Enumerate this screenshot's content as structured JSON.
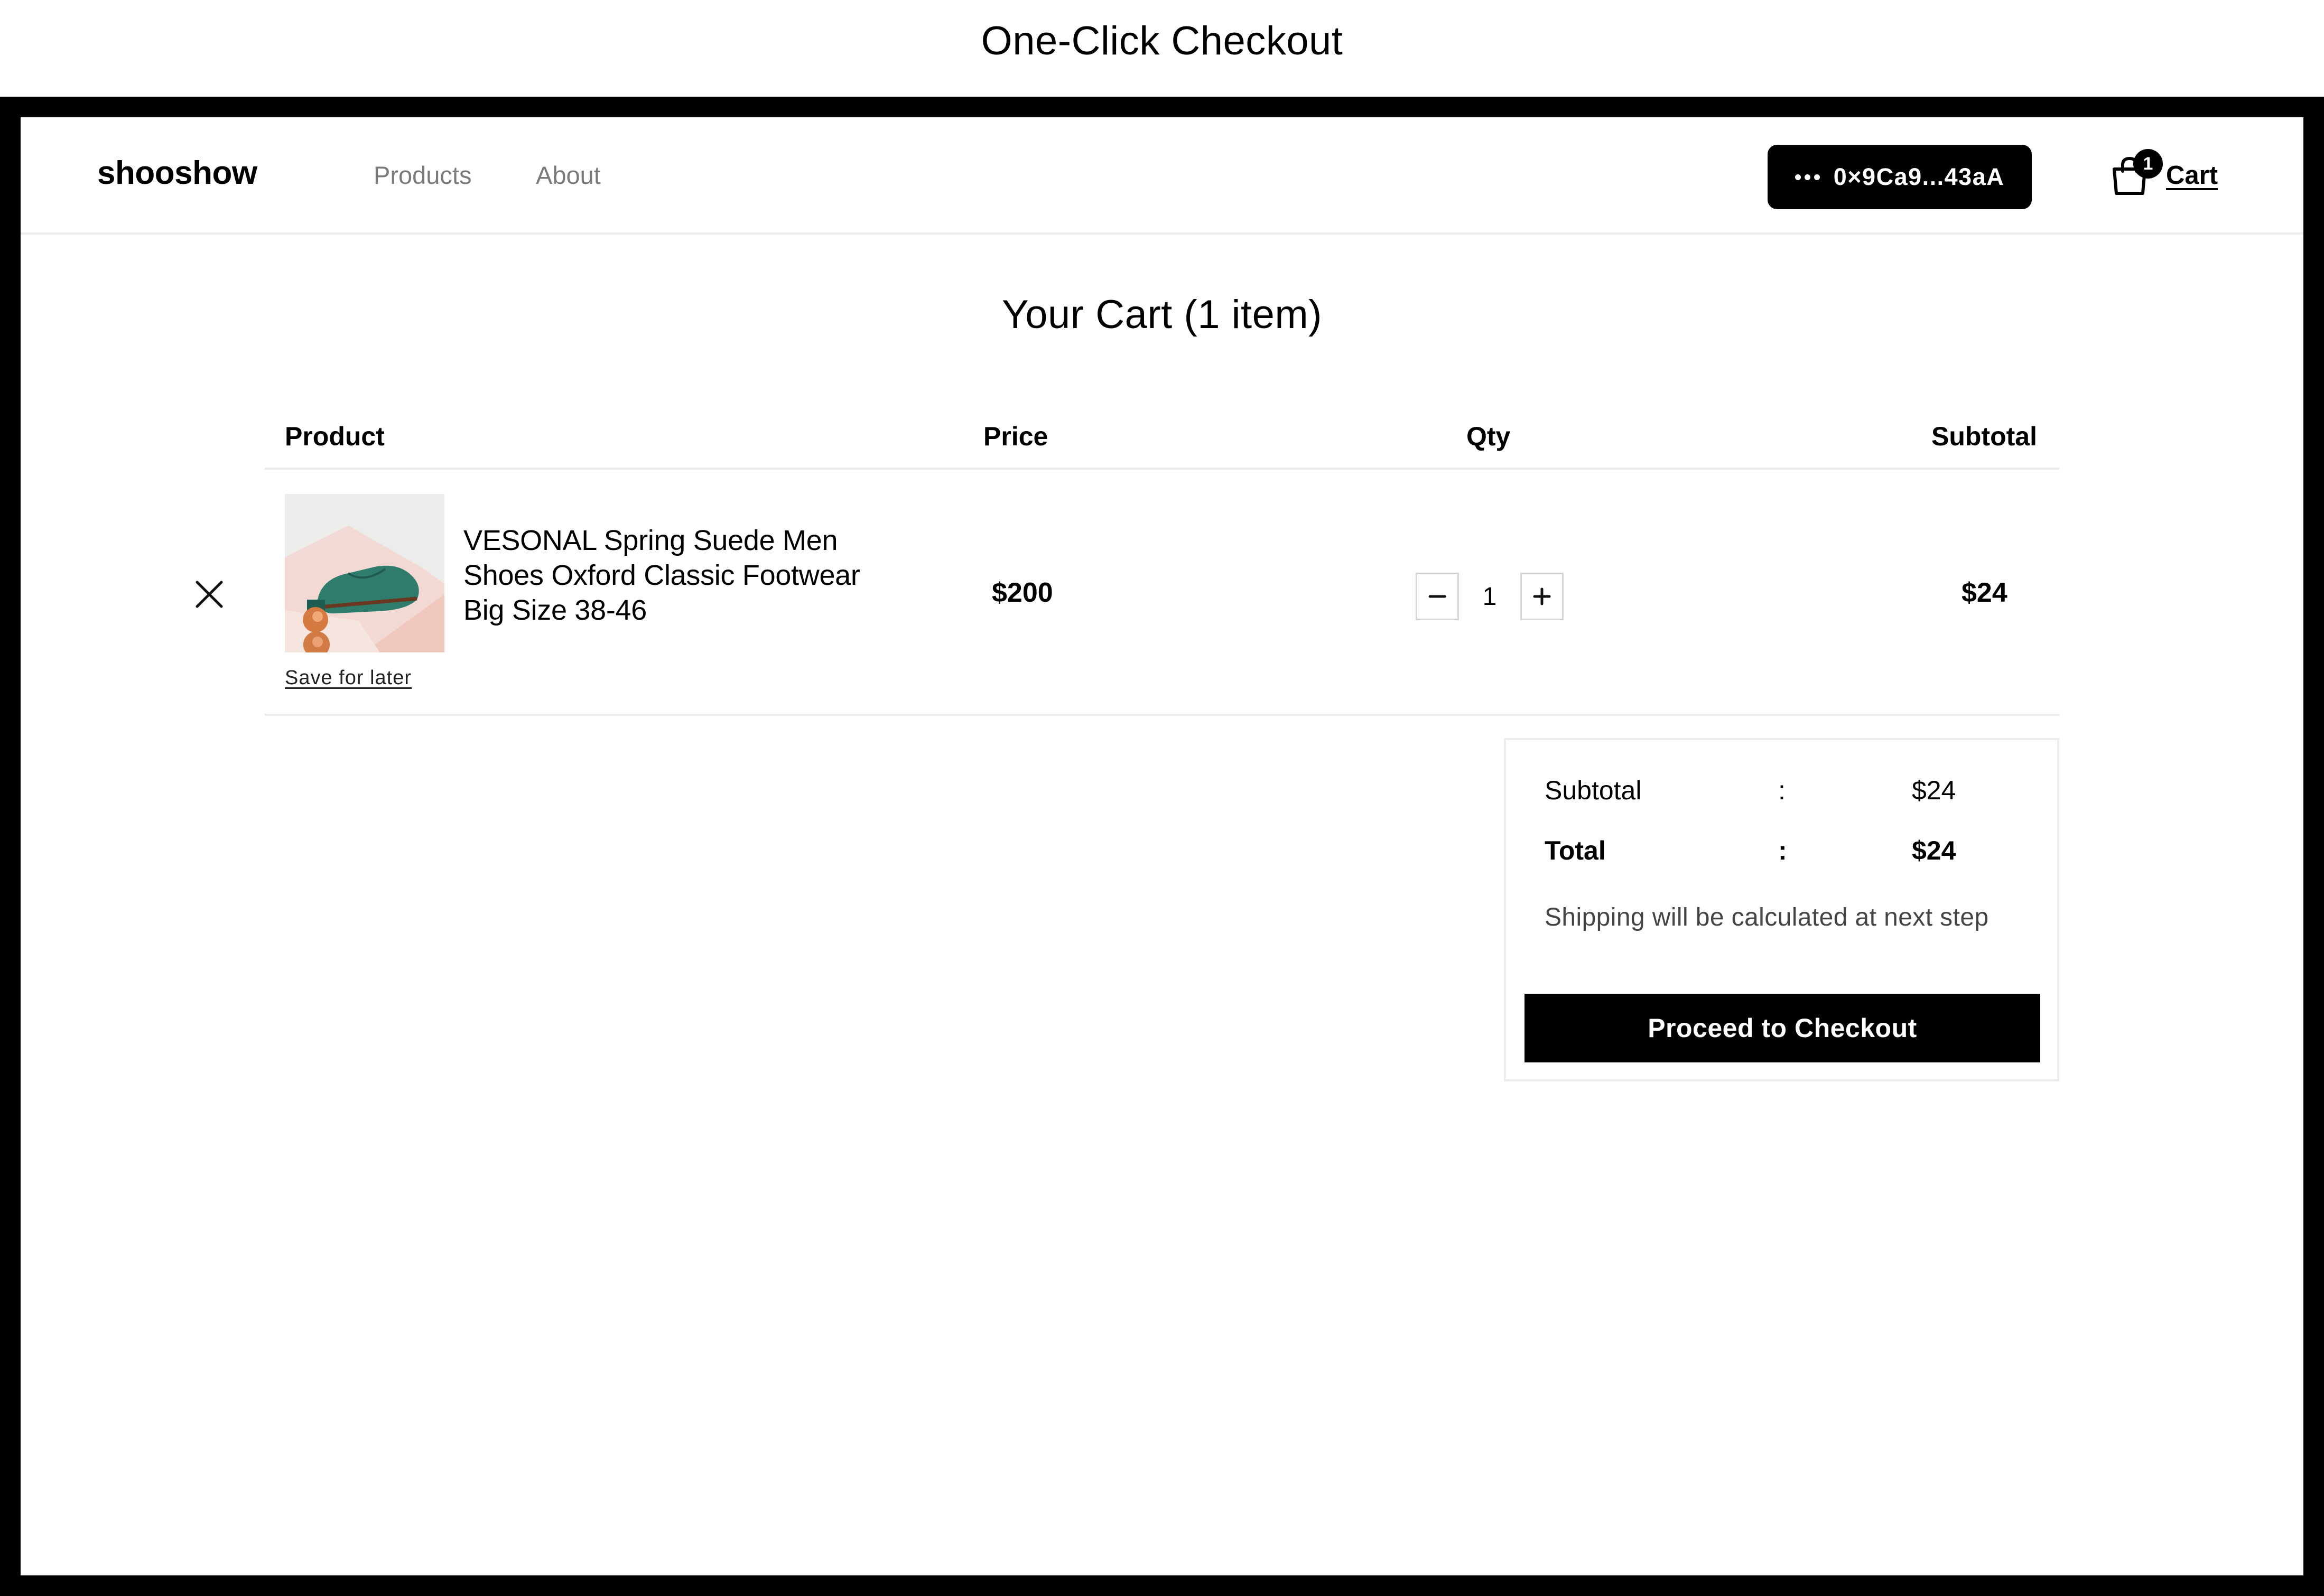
{
  "page": {
    "caption": "One-Click Checkout"
  },
  "header": {
    "logo": "shooshow",
    "nav": [
      {
        "label": "Products"
      },
      {
        "label": "About"
      }
    ],
    "wallet": {
      "icon": "dots-icon",
      "address": "0×9Ca9...43aA"
    },
    "cart": {
      "icon": "shopping-bag-icon",
      "badge_count": "1",
      "label": "Cart"
    }
  },
  "cart": {
    "title": "Your Cart (1 item)",
    "columns": {
      "product": "Product",
      "price": "Price",
      "qty": "Qty",
      "subtotal": "Subtotal"
    },
    "items": [
      {
        "name": "VESONAL Spring Suede Men Shoes Oxford Classic Footwear Big Size 38-46",
        "price": "$200",
        "qty": "1",
        "subtotal": "$24",
        "save_for_later": "Save for later",
        "image_icon": "green-suede-shoe-image"
      }
    ]
  },
  "summary": {
    "subtotal_label": "Subtotal",
    "subtotal_colon": ":",
    "subtotal_value": "$24",
    "total_label": "Total",
    "total_colon": ":",
    "total_value": "$24",
    "shipping_note": "Shipping will be calculated at next step",
    "checkout_label": "Proceed to Checkout"
  },
  "colors": {
    "primary": "#000000",
    "muted_text": "#7a7a7a",
    "border": "#ececec"
  }
}
